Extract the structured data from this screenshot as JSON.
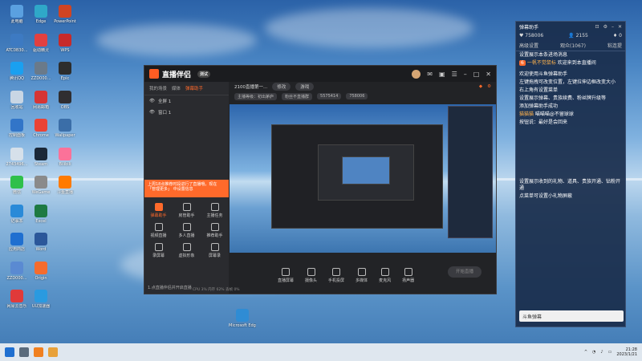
{
  "desktop": {
    "icons": [
      {
        "label": "此电脑",
        "color": "#5aa0e0"
      },
      {
        "label": "ATC0B30...",
        "color": "#3d7ac2"
      },
      {
        "label": "腾讯QQ",
        "color": "#1aa0f0"
      },
      {
        "label": "回收站",
        "color": "#c9d6e4"
      },
      {
        "label": "控制面板",
        "color": "#3275c8"
      },
      {
        "label": "2743496...",
        "color": "#d6e0ea"
      },
      {
        "label": "微信",
        "color": "#2fc04a"
      },
      {
        "label": "记事本",
        "color": "#2a8ad8"
      },
      {
        "label": "应用商店",
        "color": "#1f6fd0"
      },
      {
        "label": "ZZD000...",
        "color": "#5a8ad2"
      },
      {
        "label": "网易云音乐",
        "color": "#e03a3a"
      },
      {
        "label": "Edge",
        "color": "#2fa8c8"
      },
      {
        "label": "驱动精灵",
        "color": "#e24040"
      },
      {
        "label": "ZZD000...",
        "color": "#6a7a8a"
      },
      {
        "label": "网易邮箱",
        "color": "#d63535"
      },
      {
        "label": "Chrome",
        "color": "#ea4335"
      },
      {
        "label": "Steam",
        "color": "#1b2838"
      },
      {
        "label": "WeGame",
        "color": "#8a8a8a"
      },
      {
        "label": "Excel",
        "color": "#1e7a43"
      },
      {
        "label": "Word",
        "color": "#2b579a"
      },
      {
        "label": "Origin",
        "color": "#f56c2d"
      },
      {
        "label": "UU加速器",
        "color": "#2a9ae0"
      },
      {
        "label": "PowerPoint",
        "color": "#d04423"
      },
      {
        "label": "WPS",
        "color": "#c72a2a"
      },
      {
        "label": "Epic",
        "color": "#2d2d2d"
      },
      {
        "label": "OBS",
        "color": "#302e31"
      },
      {
        "label": "Wallpaper",
        "color": "#3b6ea8"
      },
      {
        "label": "Bilibili",
        "color": "#fb7299"
      },
      {
        "label": "斗鱼直播",
        "color": "#ff7a00"
      },
      {
        "label": "Microsoft Edge",
        "color": "#2f8cd4"
      }
    ]
  },
  "app": {
    "name": "直播伴侣",
    "version": "测试",
    "left_tabs": [
      "我的场景",
      "媒体",
      "弹幕助手"
    ],
    "scenes": [
      "全屏 1",
      "窗口 1"
    ],
    "notice": "上周18点推荐时段进行了直播哦，现在 「管理更多」 中设置信息",
    "tools": [
      {
        "label": "弹幕助手",
        "hot": true
      },
      {
        "label": "房管助手",
        "hot": false
      },
      {
        "label": "主播任务",
        "hot": false
      },
      {
        "label": "视频直播",
        "hot": false
      },
      {
        "label": "多人直播",
        "hot": false
      },
      {
        "label": "推荐助手",
        "hot": false
      },
      {
        "label": "录屏幕",
        "hot": false
      },
      {
        "label": "虚拟形象",
        "hot": false
      },
      {
        "label": "屏幕录",
        "hot": false
      }
    ],
    "left_footer": "1.点直播伴侣并开启直播",
    "room_title": "2100直播第一...",
    "room_tag": "修改",
    "category": "游戏",
    "stats": [
      "主播等级：初出茅庐",
      "粉丝不直播群",
      "5575414",
      "758006"
    ],
    "controls": [
      "直播屏幕",
      "摄像头",
      "手机投屏",
      "多媒体",
      "麦克风",
      "扬声器"
    ],
    "start_label": "开始直播",
    "bottom_stats": "CPU 3%   内存 62%   丢帧 0%"
  },
  "danmu": {
    "title": "弹幕助手",
    "fans": "758006",
    "online": "2155",
    "gifts": "0",
    "tabs": [
      "高级设置",
      "观众(1067)",
      "粘连提"
    ],
    "messages": [
      {
        "tag": "",
        "name": "",
        "text": "设置展示本条进场消息"
      },
      {
        "tag": "6",
        "name": "一帆不觉鼠标",
        "text": "欢迎来到本直播间"
      },
      {
        "tag": "",
        "name": "",
        "text": "欢迎使用斗鱼弹幕助手"
      },
      {
        "tag": "",
        "name": "",
        "text": "左键拖拽可改变位置，左键拉伸边框改变大小"
      },
      {
        "tag": "",
        "name": "",
        "text": "右上角有设置菜单"
      },
      {
        "tag": "",
        "name": "",
        "text": "设置展示弹幕、贵族续费、粉丝牌升级等"
      },
      {
        "tag": "",
        "name": "",
        "text": "添加弹幕助手成功"
      },
      {
        "tag": "",
        "name": "猫猫猫",
        "text": "喵喵喵@不留球球"
      },
      {
        "tag": "",
        "name": "",
        "text": "按钮说：最好是会回来"
      },
      {
        "tag": "",
        "name": "",
        "text": "设置展示收到的礼物、道具、贵族开通、钻粉开通"
      },
      {
        "tag": "",
        "name": "",
        "text": "点菜单可设置小礼物屏蔽"
      }
    ],
    "footer": "斗鱼弹幕"
  },
  "taskbar": {
    "time": "21:28",
    "date": "2023/1/21"
  }
}
